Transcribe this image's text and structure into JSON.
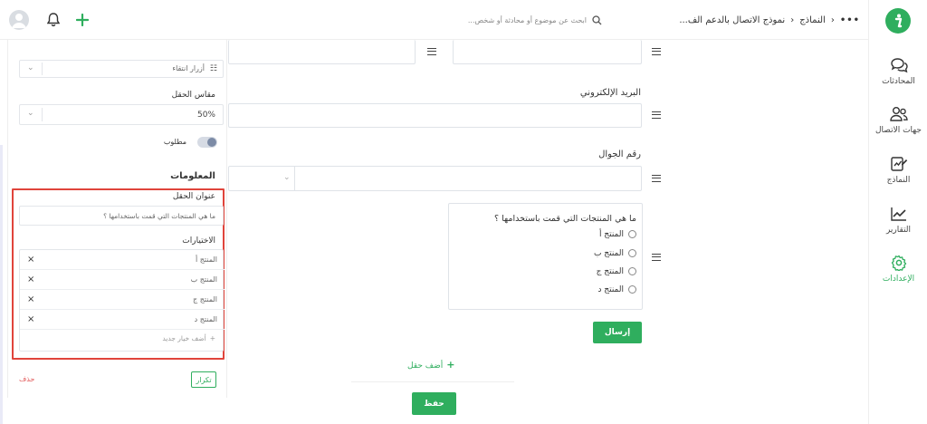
{
  "colors": {
    "accent": "#2fae5e",
    "danger": "#e25c5c",
    "highlight": "#e0443b"
  },
  "header": {
    "breadcrumb": [
      "النماذج",
      "نموذج الاتصال بالدعم الف..."
    ],
    "more_icon": "more-dots-icon",
    "search_placeholder": "ابحث عن موضوع أو محادثة أو شخص..."
  },
  "sidebar": {
    "items": [
      {
        "label": "المحادثات",
        "icon": "chat-icon",
        "active": false
      },
      {
        "label": "جهات الاتصال",
        "icon": "contacts-icon",
        "active": false
      },
      {
        "label": "النماذج",
        "icon": "forms-icon",
        "active": false
      },
      {
        "label": "التقارير",
        "icon": "reports-icon",
        "active": false
      },
      {
        "label": "الإعدادات",
        "icon": "settings-icon",
        "active": true
      }
    ]
  },
  "form_canvas": {
    "email_label": "البريد الإلكتروني",
    "phone_label": "رقم الجوال",
    "question": "ما هي المنتجات التي قمت باستخدامها ؟",
    "options": [
      "المنتج أ",
      "المنتج ب",
      "المنتج ج",
      "المنتج د"
    ],
    "submit_label": "إرسال",
    "add_field_label": "أضف حقل",
    "save_label": "حفظ"
  },
  "settings_panel": {
    "button_style_value": "أزرار انتقاء",
    "field_size_label": "مقاس الحقل",
    "field_size_value": "50%",
    "required_label": "مطلوب",
    "info_heading": "المعلومات",
    "field_title_label": "عنوان الحقل",
    "field_title_value": "ما هي المنتجات التي قمت باستخدامها ؟",
    "choices_label": "الاختيارات",
    "choices": [
      "المنتج أ",
      "المنتج ب",
      "المنتج ج",
      "المنتج د"
    ],
    "remove_symbol": "×",
    "add_choice_label": "أضف خيار جديد",
    "duplicate_label": "تكرار",
    "delete_label": "حذف"
  }
}
